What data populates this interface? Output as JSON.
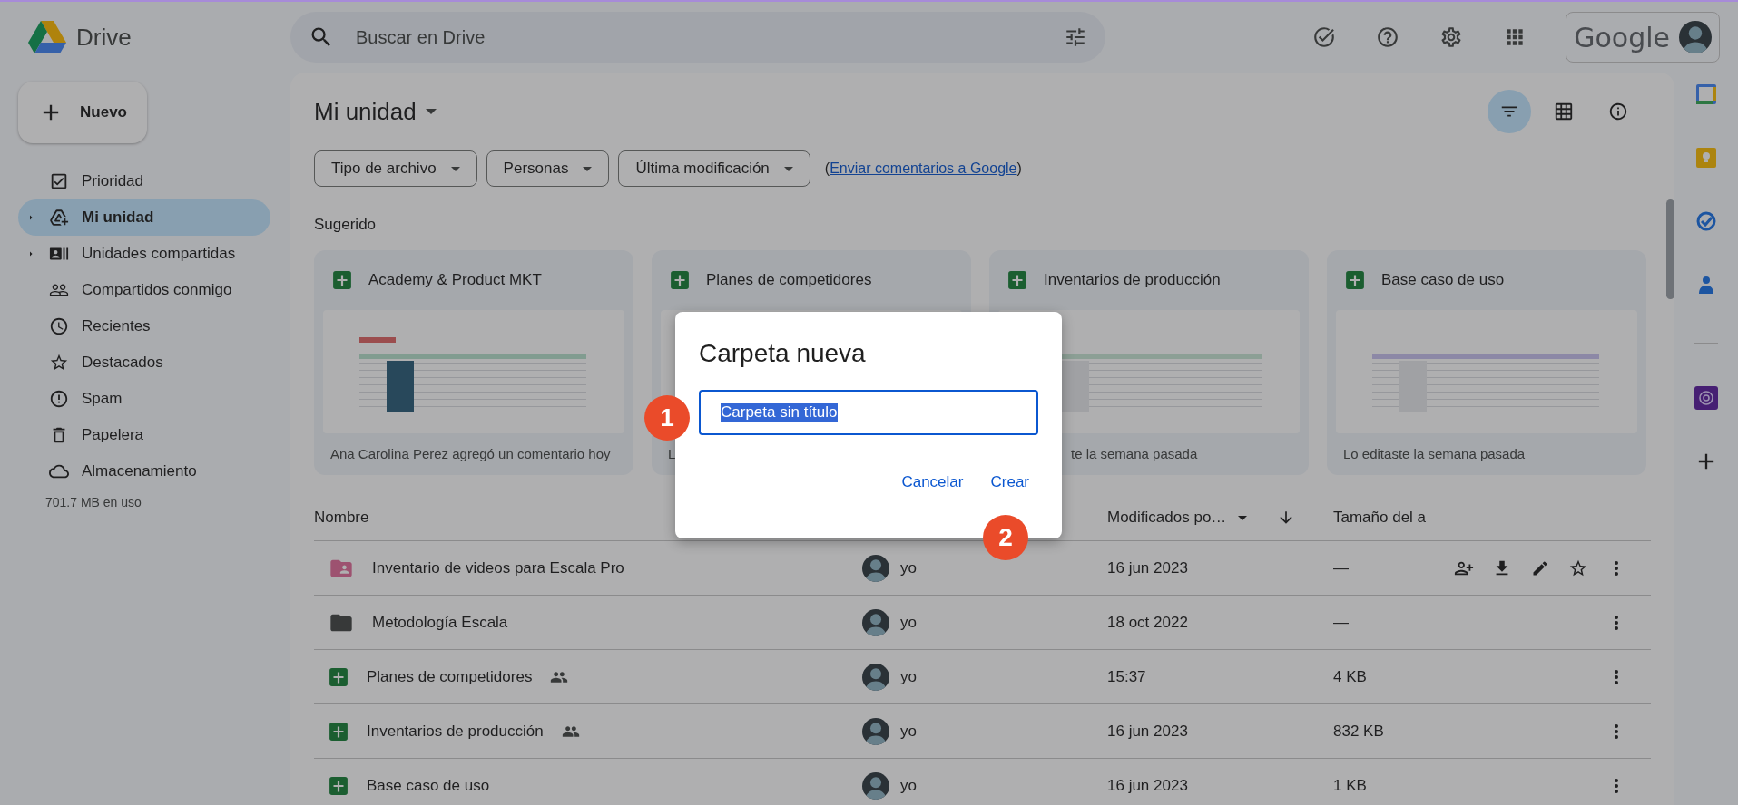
{
  "header": {
    "app_name": "Drive",
    "search": {
      "placeholder": "Buscar en Drive"
    },
    "account_label": "Google"
  },
  "sidebar": {
    "new_button": "Nuevo",
    "items": [
      {
        "label": "Prioridad",
        "selected": false,
        "expandable": false
      },
      {
        "label": "Mi unidad",
        "selected": true,
        "expandable": true
      },
      {
        "label": "Unidades compartidas",
        "selected": false,
        "expandable": true
      },
      {
        "label": "Compartidos conmigo",
        "selected": false,
        "expandable": false
      },
      {
        "label": "Recientes",
        "selected": false,
        "expandable": false
      },
      {
        "label": "Destacados",
        "selected": false,
        "expandable": false
      },
      {
        "label": "Spam",
        "selected": false,
        "expandable": false
      },
      {
        "label": "Papelera",
        "selected": false,
        "expandable": false
      },
      {
        "label": "Almacenamiento",
        "selected": false,
        "expandable": false
      }
    ],
    "storage_usage": "701.7 MB en uso"
  },
  "main": {
    "title": "Mi unidad",
    "view_buttons": [
      {
        "selected": true
      },
      {
        "selected": false
      },
      {
        "selected": false
      }
    ],
    "filters": [
      "Tipo de archivo",
      "Personas",
      "Última modificación"
    ],
    "feedback": {
      "prefix": "(",
      "link": "Enviar comentarios a Google",
      "suffix": ")"
    },
    "suggested": {
      "heading": "Sugerido",
      "cards": [
        {
          "title": "Academy & Product MKT",
          "activity": "Ana Carolina Perez agregó un comentario hoy"
        },
        {
          "title": "Planes de competidores",
          "activity": "L"
        },
        {
          "title": "Inventarios de producción",
          "activity": "te la semana pasada"
        },
        {
          "title": "Base caso de uso",
          "activity": "Lo editaste la semana pasada"
        }
      ]
    },
    "table": {
      "columns": {
        "name": "Nombre",
        "modified": "Modificados po…",
        "size": "Tamaño del a"
      },
      "rows": [
        {
          "kind": "shared_folder",
          "name": "Inventario de videos para Escala Pro",
          "shared": false,
          "owner": "yo",
          "modified": "16 jun 2023",
          "size": "—",
          "hovered": true
        },
        {
          "kind": "folder",
          "name": "Metodología Escala",
          "shared": false,
          "owner": "yo",
          "modified": "18 oct 2022",
          "size": "—",
          "hovered": false
        },
        {
          "kind": "sheet",
          "name": "Planes de competidores",
          "shared": true,
          "owner": "yo",
          "modified": "15:37",
          "size": "4 KB",
          "hovered": false
        },
        {
          "kind": "sheet",
          "name": "Inventarios de producción",
          "shared": true,
          "owner": "yo",
          "modified": "16 jun 2023",
          "size": "832 KB",
          "hovered": false
        },
        {
          "kind": "sheet",
          "name": "Base caso de uso",
          "shared": false,
          "owner": "yo",
          "modified": "16 jun 2023",
          "size": "1 KB",
          "hovered": false
        }
      ]
    }
  },
  "dialog": {
    "title": "Carpeta nueva",
    "input": {
      "value": "Carpeta sin título",
      "text_selected": true
    },
    "buttons": [
      "Cancelar",
      "Crear"
    ]
  },
  "steps": [
    "1",
    "2"
  ]
}
